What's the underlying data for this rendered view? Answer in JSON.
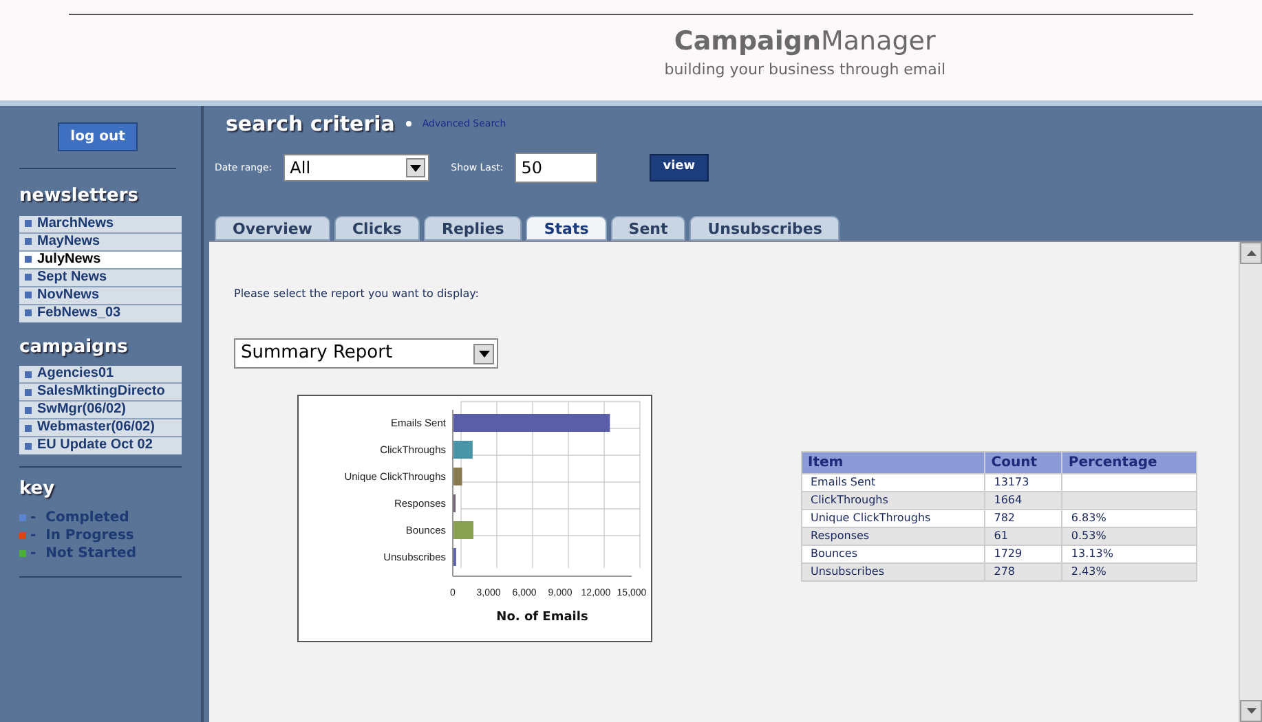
{
  "header": {
    "title_bold": "Campaign",
    "title_rest": "Manager",
    "tagline": "building your business through email"
  },
  "sidebar": {
    "logout": "log out",
    "newsletters": {
      "heading": "newsletters",
      "items": [
        {
          "label": "MarchNews",
          "selected": false
        },
        {
          "label": "MayNews",
          "selected": false
        },
        {
          "label": "JulyNews",
          "selected": true
        },
        {
          "label": "Sept News",
          "selected": false
        },
        {
          "label": "NovNews",
          "selected": false
        },
        {
          "label": "FebNews_03",
          "selected": false
        }
      ]
    },
    "campaigns": {
      "heading": "campaigns",
      "items": [
        {
          "label": "Agencies01",
          "selected": false
        },
        {
          "label": "SalesMktingDirecto",
          "selected": false
        },
        {
          "label": "SwMgr(06/02)",
          "selected": false
        },
        {
          "label": "Webmaster(06/02)",
          "selected": false
        },
        {
          "label": "EU Update Oct 02",
          "selected": false
        }
      ]
    },
    "key": {
      "heading": "key",
      "items": [
        {
          "label": "-  Completed",
          "color": "#5a84d0"
        },
        {
          "label": "-  In Progress",
          "color": "#e0401c"
        },
        {
          "label": "-  Not Started",
          "color": "#4cae3c"
        }
      ]
    }
  },
  "search": {
    "title": "search criteria",
    "advanced_link": "Advanced Search",
    "date_range_label": "Date range:",
    "date_range_value": "All",
    "show_last_label": "Show Last:",
    "show_last_value": "50",
    "view_button": "view"
  },
  "tabs": [
    {
      "label": "Overview",
      "selected": false
    },
    {
      "label": "Clicks",
      "selected": false
    },
    {
      "label": "Replies",
      "selected": false
    },
    {
      "label": "Stats",
      "selected": true
    },
    {
      "label": "Sent",
      "selected": false
    },
    {
      "label": "Unsubscribes",
      "selected": false
    }
  ],
  "report": {
    "prompt": "Please select the report you want to display:",
    "report_select": "Summary Report",
    "chart_data": {
      "type": "bar",
      "orientation": "horizontal",
      "xlabel": "No. of Emails",
      "categories": [
        "Emails Sent",
        "ClickThroughs",
        "Unique ClickThroughs",
        "Responses",
        "Bounces",
        "Unsubscribes"
      ],
      "series": [
        {
          "values": [
            13173,
            1664,
            782,
            61,
            1729,
            278
          ]
        }
      ],
      "xlim": [
        0,
        15000
      ],
      "xticks": [
        {
          "value": 0,
          "label": "0"
        },
        {
          "value": 3000,
          "label": "3,000"
        },
        {
          "value": 6000,
          "label": "6,000"
        },
        {
          "value": 9000,
          "label": "9,000"
        },
        {
          "value": 12000,
          "label": "12,000"
        },
        {
          "value": 15000,
          "label": "15,000"
        }
      ]
    },
    "bars": [
      {
        "color": "#5a5ea8"
      },
      {
        "color": "#4a94a8"
      },
      {
        "color": "#8a7a50"
      },
      {
        "color": "#6a5a6a"
      },
      {
        "color": "#88a050"
      },
      {
        "color": "#5a5ea8"
      }
    ],
    "table": {
      "columns": [
        "Item",
        "Count",
        "Percentage"
      ],
      "rows": [
        [
          "Emails Sent",
          "13173",
          ""
        ],
        [
          "ClickThroughs",
          "1664",
          ""
        ],
        [
          "Unique ClickThroughs",
          "782",
          "6.83%"
        ],
        [
          "Responses",
          "61",
          "0.53%"
        ],
        [
          "Bounces",
          "1729",
          "13.13%"
        ],
        [
          "Unsubscribes",
          "278",
          "2.43%"
        ]
      ]
    }
  }
}
